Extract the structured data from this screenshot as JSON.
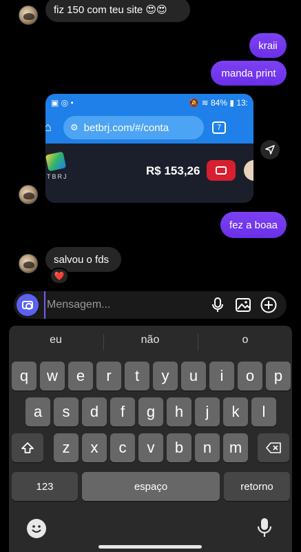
{
  "messages": {
    "top_partial": "fiz 150 com teu site 😍😍",
    "kraii": "kraii",
    "manda_print": "manda print",
    "fez_a_boaa": "fez a boaa",
    "salvou": "salvou o fds",
    "reaction": "❤️"
  },
  "shared_screenshot": {
    "battery": "84%",
    "time": "13:",
    "url": "betbrj.com/#/conta",
    "tab_count": "7",
    "logo_text": "TBRJ",
    "balance": "R$ 153,26"
  },
  "composer": {
    "placeholder": "Mensagem..."
  },
  "keyboard": {
    "suggestions": [
      "eu",
      "não",
      "o"
    ],
    "row1": [
      "q",
      "w",
      "e",
      "r",
      "t",
      "y",
      "u",
      "i",
      "o",
      "p"
    ],
    "row2": [
      "a",
      "s",
      "d",
      "f",
      "g",
      "h",
      "j",
      "k",
      "l"
    ],
    "row3": [
      "z",
      "x",
      "c",
      "v",
      "b",
      "n",
      "m"
    ],
    "numbers_key": "123",
    "space_key": "espaço",
    "return_key": "retorno"
  },
  "colors": {
    "outgoing_bubble": "#7d41f3",
    "incoming_bubble": "#262626",
    "camera_button": "#5b62f0",
    "browser_bar": "#1e80e8",
    "wallet_button": "#d71f2f"
  }
}
